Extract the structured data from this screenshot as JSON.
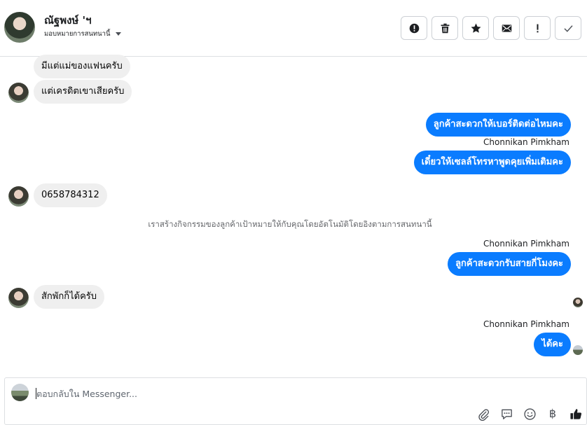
{
  "header": {
    "contact_name": "ณัฐพงษ์ 'ฯ",
    "assign_label": "มอบหมายการสนทนานี้",
    "actions": [
      {
        "id": "report",
        "icon": "alert-circle-icon"
      },
      {
        "id": "delete",
        "icon": "trash-icon"
      },
      {
        "id": "star",
        "icon": "star-icon"
      },
      {
        "id": "mail",
        "icon": "envelope-icon"
      },
      {
        "id": "follow-up",
        "icon": "exclamation-icon"
      },
      {
        "id": "done",
        "icon": "checkmark-icon"
      }
    ]
  },
  "conversation": {
    "messages": [
      {
        "direction": "in",
        "text": "มีแต่แม่ของแฟนครับ"
      },
      {
        "direction": "in",
        "text": "แต่เครดิตเขาเสียครับ"
      },
      {
        "direction": "out",
        "text": "ลูกค้าสะดวกให้เบอร์ติดต่อไหมคะ"
      },
      {
        "direction": "out",
        "sender": "Chonnikan Pimkham",
        "text": "เดี๋ยวให้เซลล์โทรหาพูดคุยเพิ่มเติมคะ"
      },
      {
        "direction": "in",
        "text": "0658784312"
      },
      {
        "direction": "system",
        "text": "เราสร้างกิจกรรมของลูกค้าเป้าหมายให้กับคุณโดยอัตโนมัติโดยอิงตามการสนทนานี้"
      },
      {
        "direction": "out",
        "sender": "Chonnikan Pimkham",
        "text": "ลูกค้าสะดวกรับสายกี่โมงคะ"
      },
      {
        "direction": "in",
        "text": "สักพักก็ได้ครับ"
      },
      {
        "direction": "out",
        "sender": "Chonnikan Pimkham",
        "text": "ได้คะ"
      }
    ]
  },
  "composer": {
    "placeholder": "ตอบกลับใน Messenger...",
    "tools": [
      "paperclip-icon",
      "quick-reply-icon",
      "emoji-icon",
      "baht-icon",
      "thumbs-up-icon"
    ],
    "baht_symbol": "฿"
  },
  "colors": {
    "outgoing_bubble": "#0a7cff",
    "incoming_bubble": "#efefef",
    "like_button": "#1c1e21"
  }
}
